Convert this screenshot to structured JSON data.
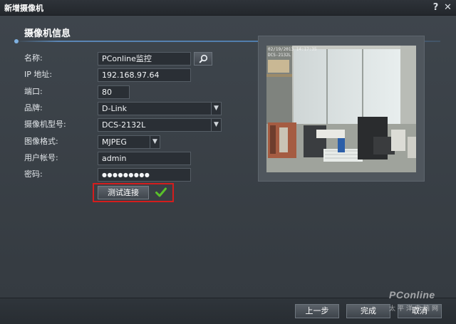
{
  "window": {
    "title": "新增摄像机",
    "help": "?",
    "close": "✕"
  },
  "section": {
    "title": "摄像机信息"
  },
  "form": {
    "name_label": "名称:",
    "name_value": "PConline监控",
    "ip_label": "IP 地址:",
    "ip_value": "192.168.97.64",
    "port_label": "端口:",
    "port_value": "80",
    "brand_label": "品牌:",
    "brand_value": "D-Link",
    "model_label": "摄像机型号:",
    "model_value": "DCS-2132L",
    "format_label": "图像格式:",
    "format_value": "MJPEG",
    "user_label": "用户帐号:",
    "user_value": "admin",
    "password_label": "密码:",
    "password_value": "●●●●●●●●●",
    "test_label": "测试连接"
  },
  "preview": {
    "osd_time": "02/19/2013 14:17:35",
    "osd_model": "DCS-2132L"
  },
  "footer": {
    "back_label": "上一步",
    "finish_label": "完成",
    "cancel_label": "取消"
  },
  "watermark": {
    "brand": "PConline",
    "sub": "太平洋电脑网"
  },
  "colors": {
    "highlight_border": "#d41d1d",
    "check": "#5ac12a",
    "accent_line": "#4e7aa8"
  }
}
